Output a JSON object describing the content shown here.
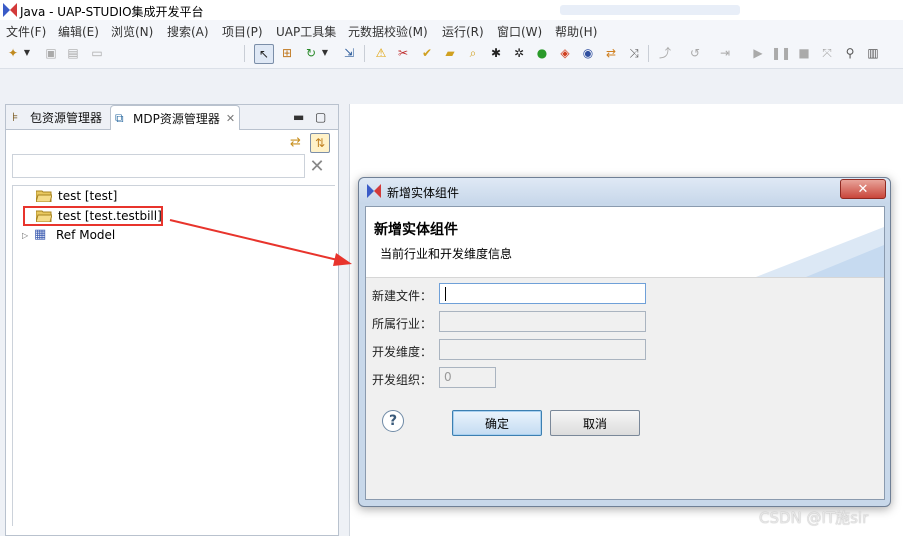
{
  "window": {
    "title": "Java - UAP-STUDIO集成开发平台"
  },
  "menubar": {
    "items": [
      "文件(F)",
      "编辑(E)",
      "浏览(N)",
      "搜索(A)",
      "项目(P)",
      "UAP工具集",
      "元数据校验(M)",
      "运行(R)",
      "窗口(W)",
      "帮助(H)"
    ]
  },
  "left_panel": {
    "tabs": [
      {
        "label": "包资源管理器"
      },
      {
        "label": "MDP资源管理器",
        "close": "✕"
      }
    ],
    "tree": [
      {
        "label": "test [test]"
      },
      {
        "label": "test [test.testbill]"
      },
      {
        "label": "Ref Model"
      }
    ]
  },
  "dialog": {
    "title": "新增实体组件",
    "header_title": "新增实体组件",
    "header_desc": "当前行业和开发维度信息",
    "fields": [
      {
        "label": "新建文件：",
        "value": ""
      },
      {
        "label": "所属行业：",
        "value": ""
      },
      {
        "label": "开发维度：",
        "value": ""
      },
      {
        "label": "开发组织：",
        "value": "0"
      }
    ],
    "ok_label": "确定",
    "cancel_label": "取消",
    "close_glyph": "✕",
    "help_glyph": "?"
  },
  "watermark": "CSDN @IT施sir",
  "colors": {
    "highlight_box": "#e8342c",
    "arrow": "#e8342c"
  }
}
